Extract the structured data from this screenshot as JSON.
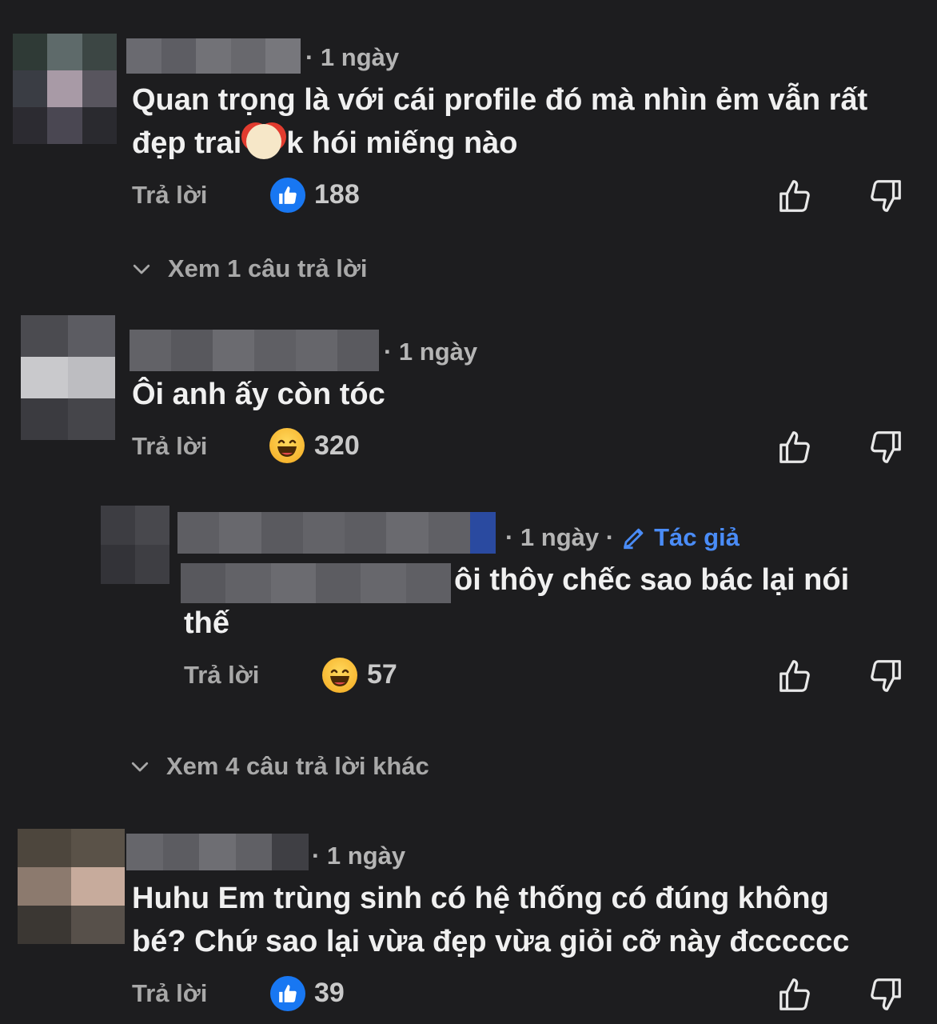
{
  "comments": [
    {
      "time": "· 1 ngày",
      "text_before_emoji": "Quan trọng là với cái profile đó mà nhìn ẻm vẫn rất đẹp trai",
      "emoji": "clown-face",
      "text_after_emoji": "k hói miếng nào",
      "reply_label": "Trả lời",
      "reaction": "like",
      "reaction_count": "188",
      "expand_label": "Xem 1 câu trả lời"
    },
    {
      "time": "· 1 ngày",
      "text": "Ôi anh ấy còn tóc",
      "reply_label": "Trả lời",
      "reaction": "haha",
      "reaction_count": "320",
      "reply": {
        "time": "· 1 ngày ·",
        "author_badge": "Tác giả",
        "text_line1": "ôi thôy chếc sao bác lại nói",
        "text_line2": "thế",
        "reply_label": "Trả lời",
        "reaction": "haha",
        "reaction_count": "57"
      },
      "expand_label": "Xem 4 câu trả lời khác"
    },
    {
      "time": "· 1 ngày",
      "text_line1": "Huhu Em trùng sinh có hệ thống có đúng không",
      "text_line2": "bé? Chứ sao lại vừa đẹp vừa giỏi cỡ này đcccccc",
      "reply_label": "Trả lời",
      "reaction": "like",
      "reaction_count": "39"
    }
  ],
  "icons": {
    "like_button": "thumbs-up-icon",
    "dislike_button": "thumbs-down-icon",
    "expand": "chevron-down-icon",
    "author": "pencil-icon"
  },
  "colors": {
    "background": "#1d1d1f",
    "like_blue": "#1877f2",
    "author_blue": "#4a8cf7"
  }
}
